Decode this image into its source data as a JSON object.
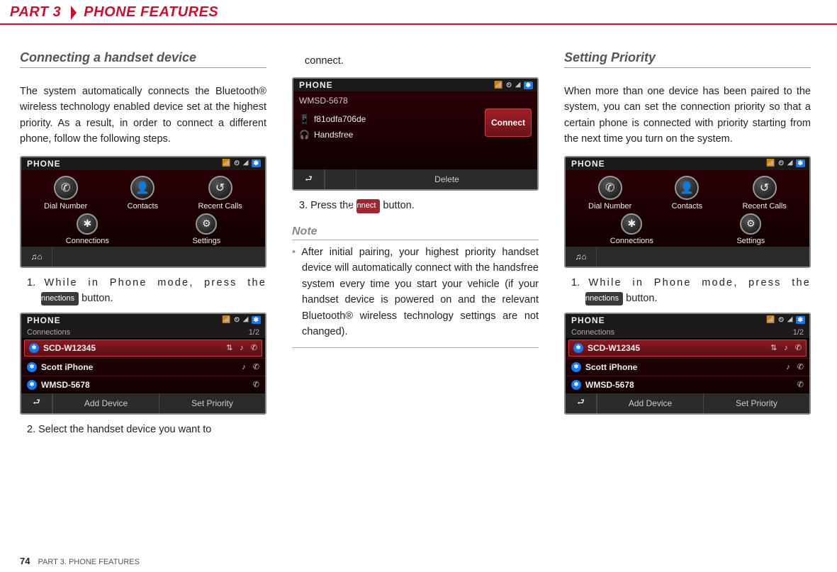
{
  "header": {
    "part": "PART 3",
    "title": "PHONE FEATURES"
  },
  "footer": {
    "pagenum": "74",
    "text": "PART 3. PHONE FEATURES"
  },
  "col1": {
    "heading": "Connecting a handset device",
    "intro": "The system automatically connects the Bluetooth® wireless technology enabled device set at the highest priority. As a result, in order to connect a different phone, follow the following steps.",
    "step1_pre": "1. ",
    "step1_a": "While in Phone mode, press the",
    "step1_btn": "Connections",
    "step1_b": " button.",
    "step2": "2. Select the handset device you want to"
  },
  "col2": {
    "top": "connect.",
    "step3_a": "3. Press the ",
    "step3_btn": "Connect",
    "step3_b": " button.",
    "note_heading": "Note",
    "note_text": "After initial pairing, your highest priority handset device will automatically connect with the handsfree system every time you start your vehicle (if your handset device is powered on and the relevant Bluetooth® wireless technology settings are not changed)."
  },
  "col3": {
    "heading": "Setting Priority",
    "intro": "When more than one device has been paired to the system, you can set the connection priority so that a certain phone is connected with priority starting from the next time you turn on the system.",
    "step1_pre": "1. ",
    "step1_a": "While in Phone mode, press the",
    "step1_btn": "Connections",
    "step1_b": " button."
  },
  "shots": {
    "status_title": "PHONE",
    "menu": {
      "dial": "Dial Number",
      "contacts": "Contacts",
      "recent": "Recent Calls",
      "connections": "Connections",
      "settings": "Settings"
    },
    "connlist": {
      "sub": "Connections",
      "page": "1/2",
      "d1": "SCD-W12345",
      "d2": "Scott iPhone",
      "d3": "WMSD-5678",
      "add": "Add Device",
      "pri": "Set Priority"
    },
    "detail": {
      "sub": "WMSD-5678",
      "devname": "f81odfa706de",
      "hf": "Handsfree",
      "connect": "Connect",
      "delete": "Delete"
    }
  }
}
